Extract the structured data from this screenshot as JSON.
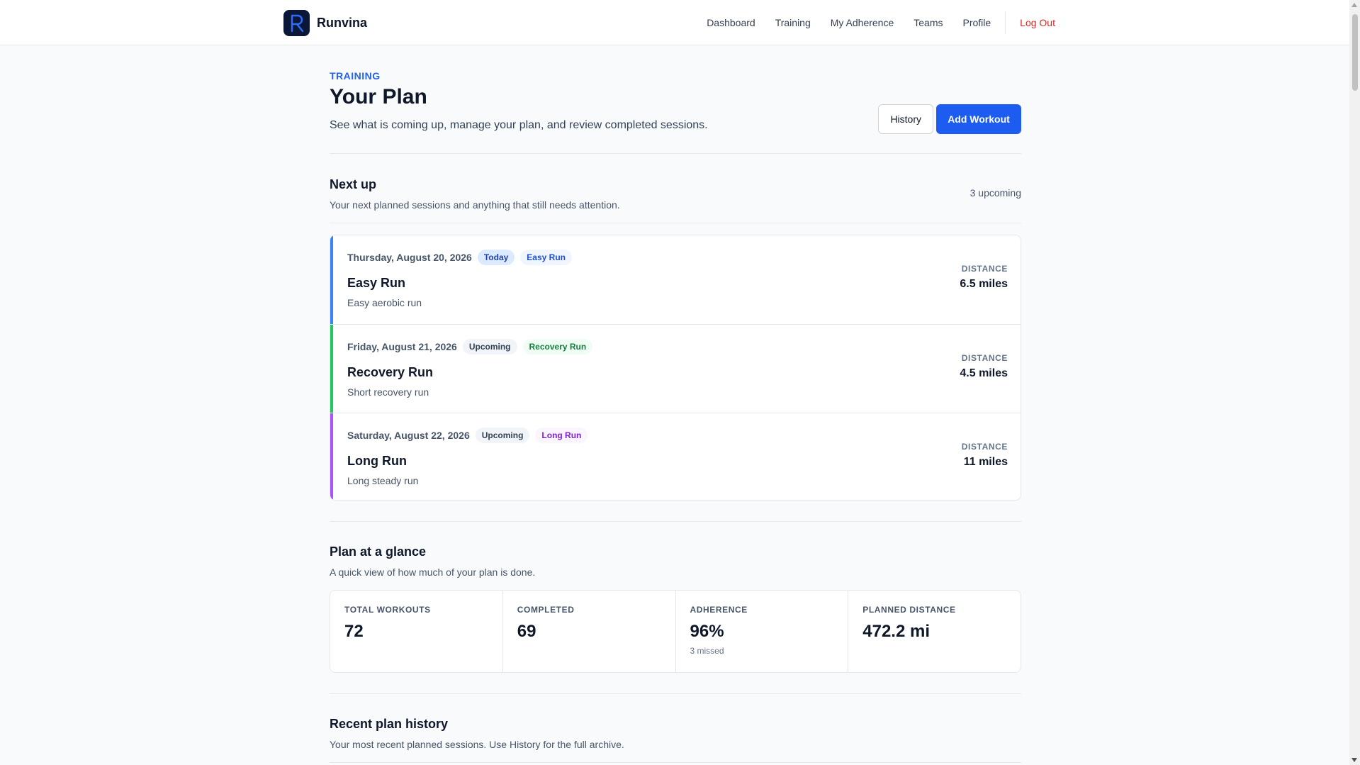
{
  "brand": {
    "name": "Runvina",
    "logo_letter": "R"
  },
  "nav": {
    "items": [
      "Dashboard",
      "Training",
      "My Adherence",
      "Teams",
      "Profile"
    ],
    "logout": "Log Out"
  },
  "header": {
    "eyebrow": "TRAINING",
    "title": "Your Plan",
    "subtitle": "See what is coming up, manage your plan, and review completed sessions.",
    "history_label": "History",
    "add_label": "Add Workout"
  },
  "next_up": {
    "title": "Next up",
    "subtitle": "Your next planned sessions and anything that still needs attention.",
    "count": "3 upcoming",
    "workouts": [
      {
        "date": "Thursday, August 20, 2026",
        "status": "Today",
        "type": "Easy Run",
        "title": "Easy Run",
        "description": "Easy aerobic run",
        "distance_label": "DISTANCE",
        "distance": "6.5 miles",
        "accent": "#3b82f6",
        "status_bg": "#dbeafe",
        "status_color": "#1e40af",
        "type_bg": "#eff6ff",
        "type_color": "#1d4ed8"
      },
      {
        "date": "Friday, August 21, 2026",
        "status": "Upcoming",
        "type": "Recovery Run",
        "title": "Recovery Run",
        "description": "Short recovery run",
        "distance_label": "DISTANCE",
        "distance": "4.5 miles",
        "accent": "#22c55e",
        "status_bg": "#f1f5f9",
        "status_color": "#334155",
        "type_bg": "#f0fdf4",
        "type_color": "#15803d"
      },
      {
        "date": "Saturday, August 22, 2026",
        "status": "Upcoming",
        "type": "Long Run",
        "title": "Long Run",
        "description": "Long steady run",
        "distance_label": "DISTANCE",
        "distance": "11 miles",
        "accent": "#a855f7",
        "status_bg": "#f1f5f9",
        "status_color": "#334155",
        "type_bg": "#faf5ff",
        "type_color": "#7e22ce"
      }
    ]
  },
  "glance": {
    "title": "Plan at a glance",
    "subtitle": "A quick view of how much of your plan is done.",
    "stats": [
      {
        "label": "TOTAL WORKOUTS",
        "value": "72",
        "note": ""
      },
      {
        "label": "COMPLETED",
        "value": "69",
        "note": ""
      },
      {
        "label": "ADHERENCE",
        "value": "96%",
        "note": "3 missed"
      },
      {
        "label": "PLANNED DISTANCE",
        "value": "472.2 mi",
        "note": ""
      }
    ]
  },
  "history": {
    "title": "Recent plan history",
    "subtitle": "Your most recent planned sessions. Use History for the full archive."
  }
}
